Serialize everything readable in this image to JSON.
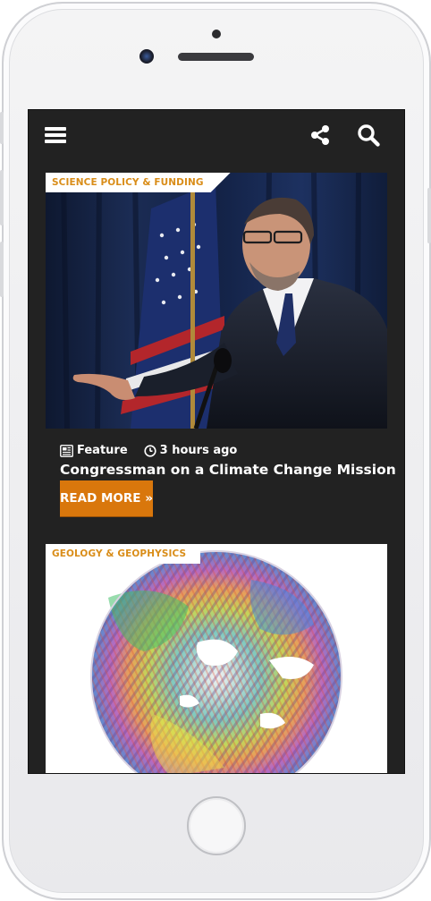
{
  "nav": {
    "menu_icon": "hamburger-menu-icon",
    "share_icon": "share-icon",
    "search_icon": "search-icon"
  },
  "articles": [
    {
      "category": "SCIENCE POLICY & FUNDING",
      "meta_type": "Feature",
      "meta_time": "3 hours ago",
      "headline": "Congressman on a Climate Change Mission",
      "read_more": "READ MORE »"
    },
    {
      "category": "GEOLOGY & GEOPHYSICS"
    }
  ],
  "colors": {
    "accent": "#d9770c",
    "category_text": "#d98d19",
    "screen_bg": "#222222"
  }
}
